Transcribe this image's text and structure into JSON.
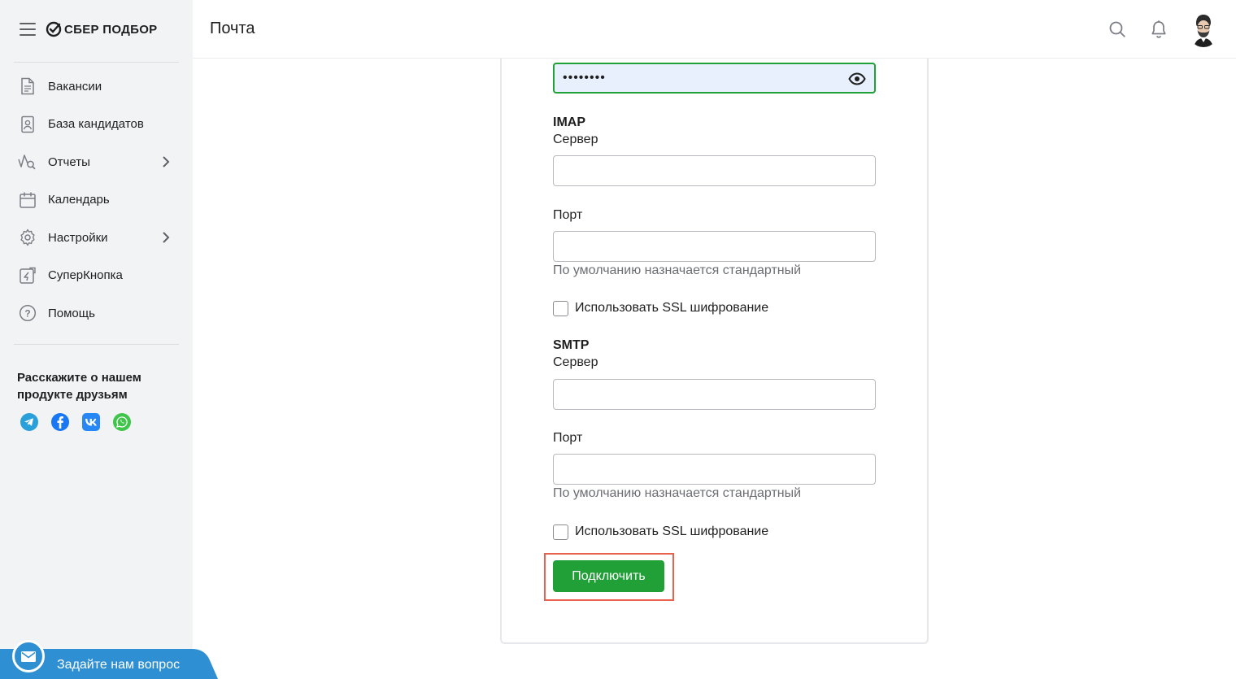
{
  "brand": {
    "name": "СБЕР ПОДБОР"
  },
  "sidebar": {
    "items": [
      {
        "label": "Вакансии",
        "icon": "document-icon"
      },
      {
        "label": "База кандидатов",
        "icon": "person-card-icon"
      },
      {
        "label": "Отчеты",
        "icon": "chart-search-icon",
        "has_submenu": true
      },
      {
        "label": "Календарь",
        "icon": "calendar-icon"
      },
      {
        "label": "Настройки",
        "icon": "gear-icon",
        "has_submenu": true
      },
      {
        "label": "СуперКнопка",
        "icon": "super-button-icon"
      },
      {
        "label": "Помощь",
        "icon": "help-icon"
      }
    ],
    "promo_title": "Расскажите о нашем продукте друзьям",
    "socials": [
      "telegram-icon",
      "facebook-icon",
      "vk-icon",
      "whatsapp-icon"
    ],
    "help_chat_label": "Задайте нам вопрос"
  },
  "header": {
    "title": "Почта"
  },
  "form": {
    "password_value": "••••••••",
    "imap": {
      "title": "IMAP",
      "server_label": "Сервер",
      "server_value": "",
      "port_label": "Порт",
      "port_value": "",
      "port_hint": "По умолчанию назначается стандартный",
      "ssl_label": "Использовать SSL шифрование",
      "ssl_checked": false
    },
    "smtp": {
      "title": "SMTP",
      "server_label": "Сервер",
      "server_value": "",
      "port_label": "Порт",
      "port_value": "",
      "port_hint": "По умолчанию назначается стандартный",
      "ssl_label": "Использовать SSL шифрование",
      "ssl_checked": false
    },
    "submit_label": "Подключить"
  },
  "colors": {
    "accent_green": "#21a038",
    "highlight_red": "#e8624d",
    "sidebar_bg": "#f2f3f5",
    "help_blue": "#2f8fd3"
  }
}
